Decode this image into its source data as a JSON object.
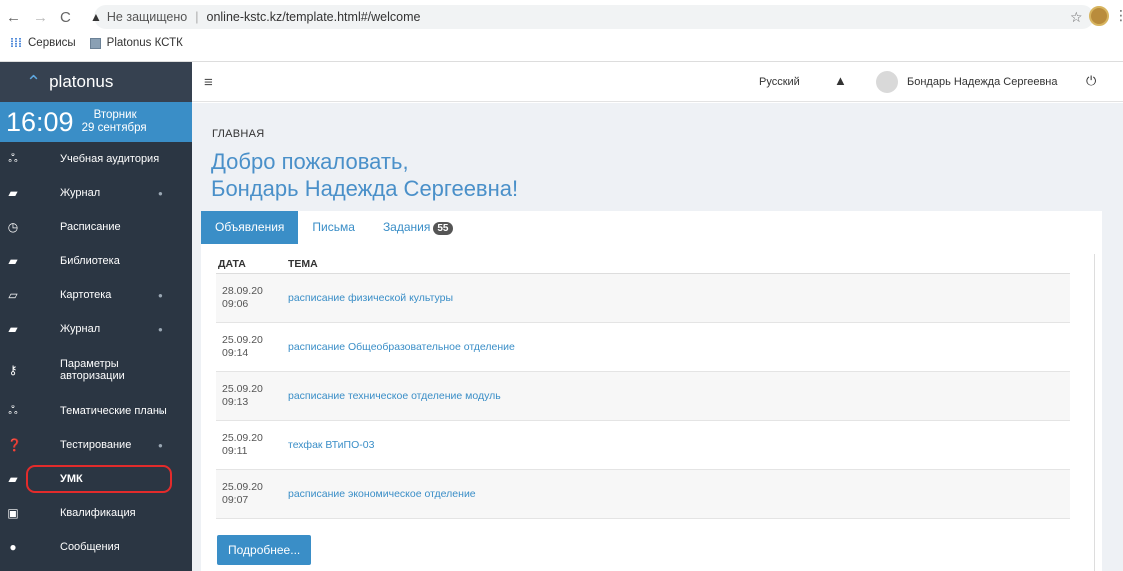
{
  "browser": {
    "not_secure": "Не защищено",
    "url": "online-kstc.kz/template.html#/welcome",
    "bookmarks": [
      "Сервисы",
      "Platonus КСТК"
    ]
  },
  "app": {
    "brand": "platonus",
    "clock": {
      "time": "16:09",
      "weekday": "Вторник",
      "date": "29 сентября"
    },
    "menu": [
      {
        "label": "Учебная аудитория",
        "icon": "users-icon",
        "arrow": false
      },
      {
        "label": "Журнал",
        "icon": "book-icon",
        "arrow": true
      },
      {
        "label": "Расписание",
        "icon": "clock-icon",
        "arrow": false
      },
      {
        "label": "Библиотека",
        "icon": "book-icon",
        "arrow": false
      },
      {
        "label": "Картотека",
        "icon": "folder-icon",
        "arrow": true
      },
      {
        "label": "Журнал",
        "icon": "book-icon",
        "arrow": true
      },
      {
        "label": "Параметры авторизации",
        "icon": "key-icon",
        "arrow": false
      },
      {
        "label": "Тематические планы",
        "icon": "users-icon",
        "arrow": true
      },
      {
        "label": "Тестирование",
        "icon": "question-icon",
        "arrow": true
      },
      {
        "label": "УМК",
        "icon": "book-icon",
        "arrow": false
      },
      {
        "label": "Квалификация",
        "icon": "certificate-icon",
        "arrow": false
      },
      {
        "label": "Сообщения",
        "icon": "comments-icon",
        "arrow": false
      }
    ],
    "topbar": {
      "language": "Русский",
      "user": "Бондарь Надежда Сергеевна"
    },
    "breadcrumb": "ГЛАВНАЯ",
    "welcome_line1": "Добро пожаловать,",
    "welcome_line2": "Бондарь Надежда Сергеевна!",
    "tabs": [
      {
        "label": "Объявления",
        "active": true
      },
      {
        "label": "Письма",
        "active": false
      },
      {
        "label": "Задания",
        "active": false,
        "badge": "55"
      }
    ],
    "table": {
      "headers": [
        "ДАТА",
        "ТЕМА"
      ],
      "rows": [
        {
          "date": "28.09.20",
          "time": "09:06",
          "topic": "расписание физической культуры"
        },
        {
          "date": "25.09.20",
          "time": "09:14",
          "topic": "расписание Общеобразовательное отделение"
        },
        {
          "date": "25.09.20",
          "time": "09:13",
          "topic": "расписание техническое отделение модуль"
        },
        {
          "date": "25.09.20",
          "time": "09:11",
          "topic": "техфак ВТиПО-03"
        },
        {
          "date": "25.09.20",
          "time": "09:07",
          "topic": "расписание экономическое отделение"
        }
      ]
    },
    "more_button": "Подробнее..."
  }
}
